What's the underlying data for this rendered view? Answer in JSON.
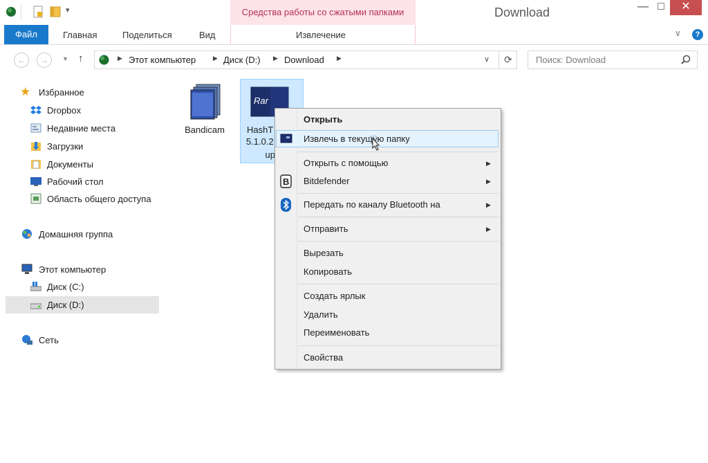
{
  "window": {
    "title": "Download",
    "context_group": "Средства работы со сжатыми папками",
    "controls": {
      "minimize": "—",
      "maximize": "□",
      "close": "✕"
    }
  },
  "ribbon": {
    "tabs": [
      "Файл",
      "Главная",
      "Поделиться",
      "Вид",
      "Извлечение"
    ],
    "help": "?"
  },
  "address": {
    "crumbs": [
      "Этот компьютер",
      "Диск (D:)",
      "Download"
    ],
    "search_placeholder": "Поиск: Download"
  },
  "navpane": {
    "favorites": "Избранное",
    "favorites_items": [
      "Dropbox",
      "Недавние места",
      "Загрузки",
      "Документы",
      "Рабочий стол",
      "Область общего доступа"
    ],
    "homegroup": "Домашняя группа",
    "computer": "Этот компьютер",
    "computer_items": [
      "Диск (C:)",
      "Диск (D:)"
    ],
    "network": "Сеть"
  },
  "files": [
    {
      "name": "Bandicam"
    },
    {
      "name_lines": [
        "HashT",
        "5.1.0.2",
        "up"
      ],
      "icon_text": "Rar"
    }
  ],
  "context_menu": {
    "items": [
      "Открыть",
      "Извлечь в текущую папку",
      "Открыть с помощью",
      "Bitdefender",
      "Передать по каналу Bluetooth на",
      "Отправить",
      "Вырезать",
      "Копировать",
      "Создать ярлык",
      "Удалить",
      "Переименовать",
      "Свойства"
    ]
  },
  "colors": {
    "file_tab": "#1979ca",
    "context_tools_bg": "#fde3ea",
    "context_tools_text": "#b4305a",
    "selection": "#cde8ff"
  }
}
